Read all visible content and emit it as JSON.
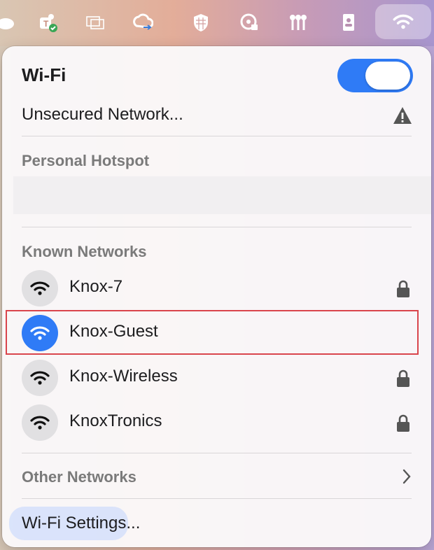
{
  "menubar": {
    "icons": [
      "cloud-icon",
      "teams-icon",
      "display-mirror-icon",
      "creative-cloud-sync-icon",
      "shield-grid-icon",
      "vpn-lock-icon",
      "keys-icon",
      "contact-card-icon",
      "wifi-icon"
    ]
  },
  "wifi_menu": {
    "title": "Wi-Fi",
    "enabled": true,
    "unsecured_label": "Unsecured Network...",
    "personal_hotspot_header": "Personal Hotspot",
    "known_networks_header": "Known Networks",
    "known_networks": [
      {
        "name": "Knox-7",
        "locked": true,
        "connected": false
      },
      {
        "name": "Knox-Guest",
        "locked": false,
        "connected": true
      },
      {
        "name": "Knox-Wireless",
        "locked": true,
        "connected": false
      },
      {
        "name": "KnoxTronics",
        "locked": true,
        "connected": false
      }
    ],
    "other_networks_label": "Other Networks",
    "settings_label": "Wi-Fi Settings..."
  },
  "colors": {
    "accent": "#2f7bf6",
    "highlight_border": "#d9454c"
  }
}
